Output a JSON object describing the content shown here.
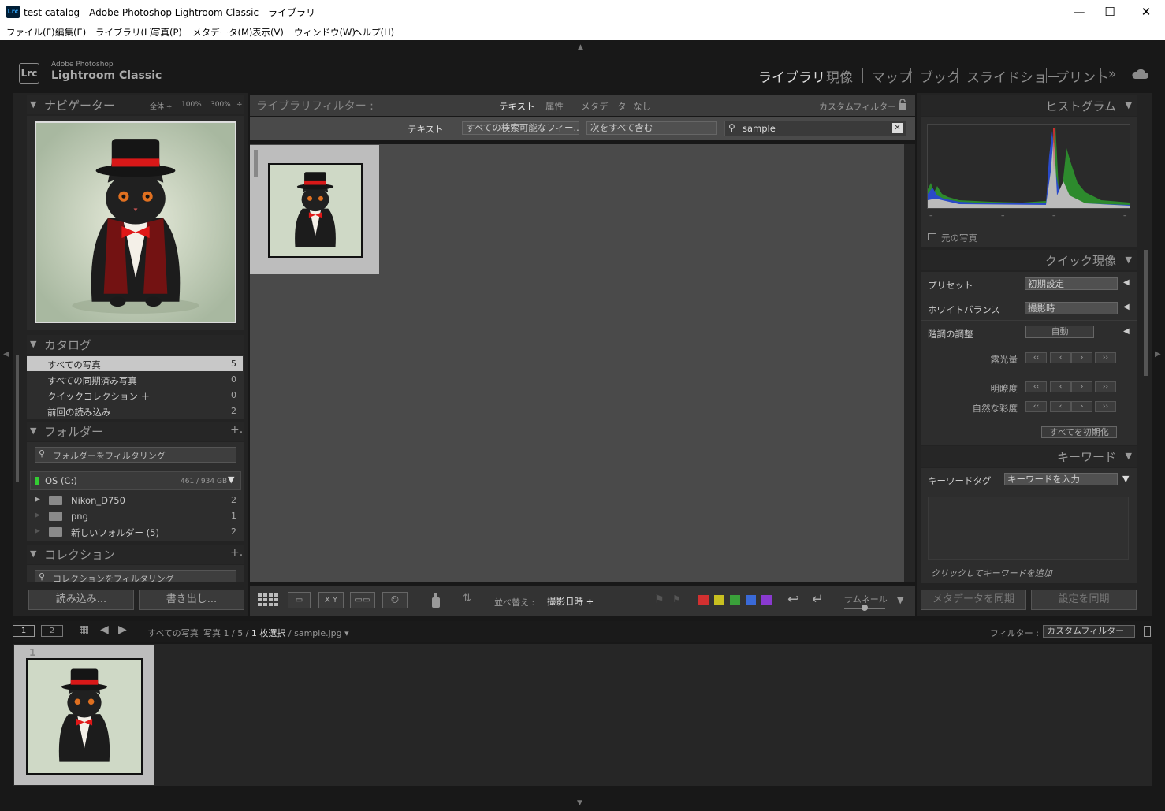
{
  "window": {
    "title": "test catalog - Adobe Photoshop Lightroom Classic - ライブラリ",
    "app_icon": "Lrc",
    "minimize": "—",
    "maximize": "☐",
    "close": "✕"
  },
  "menu": [
    "ファイル(F)",
    "編集(E)",
    "ライブラリ(L)",
    "写真(P)",
    "メタデータ(M)",
    "表示(V)",
    "ウィンドウ(W)",
    "ヘルプ(H)"
  ],
  "brand": {
    "logo": "Lrc",
    "line1": "Adobe Photoshop",
    "line2": "Lightroom Classic"
  },
  "modules": [
    "ライブラリ",
    "現像",
    "マップ",
    "ブック",
    "スライドショー",
    "プリント"
  ],
  "modules_more": "»",
  "navigator": {
    "title": "ナビゲーター",
    "zoom": [
      "全体 ÷",
      "100%",
      "300%",
      "÷"
    ]
  },
  "catalog": {
    "title": "カタログ",
    "items": [
      {
        "label": "すべての写真",
        "count": "5"
      },
      {
        "label": "すべての同期済み写真",
        "count": "0"
      },
      {
        "label": "クイックコレクション ＋",
        "count": "0"
      },
      {
        "label": "前回の読み込み",
        "count": "2"
      }
    ]
  },
  "folders": {
    "title": "フォルダー",
    "add": "+.",
    "filter_placeholder": "フォルダーをフィルタリング",
    "volume": {
      "name": "OS (C:)",
      "size": "461 / 934 GB"
    },
    "items": [
      {
        "label": "Nikon_D750",
        "count": "2"
      },
      {
        "label": "png",
        "count": "1"
      },
      {
        "label": "新しいフォルダー (5)",
        "count": "2"
      }
    ]
  },
  "collections": {
    "title": "コレクション",
    "add": "+.",
    "filter_placeholder": "コレクションをフィルタリング"
  },
  "left_buttons": {
    "import": "読み込み...",
    "export": "書き出し..."
  },
  "filterbar": {
    "title": "ライブラリフィルター :",
    "tabs": [
      "テキスト",
      "属性",
      "メタデータ",
      "なし"
    ],
    "custom": "カスタムフィルター ÷",
    "text_label": "テキスト",
    "field_select": "すべての検索可能なフィー... ÷",
    "rule_select": "次をすべて含む",
    "search_value": "sample"
  },
  "toolbar": {
    "sort_label": "並べ替え :",
    "sort_value": "撮影日時 ÷",
    "thumb_label": "サムネール",
    "swatches": [
      "#d23030",
      "#c8c020",
      "#3aa03a",
      "#3a6ad8",
      "#8a3ad0"
    ]
  },
  "histogram": {
    "title": "ヒストグラム",
    "original": "元の写真",
    "ticks": [
      "–",
      "–",
      "–",
      "–"
    ]
  },
  "quick_develop": {
    "title": "クイック現像",
    "preset_label": "プリセット",
    "preset_value": "初期設定",
    "wb_label": "ホワイトバランス",
    "wb_value": "撮影時",
    "tone_label": "階調の調整",
    "auto_label": "自動",
    "rows": [
      "露光量",
      "明瞭度",
      "自然な彩度"
    ],
    "step_glyphs": [
      "‹‹",
      "‹",
      "›",
      "››"
    ],
    "reset_label": "すべてを初期化"
  },
  "keywords": {
    "title": "キーワード",
    "tag_label": "キーワードタグ",
    "tag_value": "キーワードを入力",
    "add_hint": "クリックしてキーワードを追加"
  },
  "right_buttons": {
    "sync_meta": "メタデータを同期",
    "sync_settings": "設定を同期"
  },
  "filmstrip": {
    "screen1": "1",
    "screen2": "2",
    "path": "すべての写真",
    "info_pre": "写真 1 / 5 / ",
    "info_sel": "1 枚選択",
    "info_post": " / sample.jpg ▾",
    "filter_label": "フィルター :",
    "filter_value": "カスタムフィルター",
    "index": "1"
  }
}
